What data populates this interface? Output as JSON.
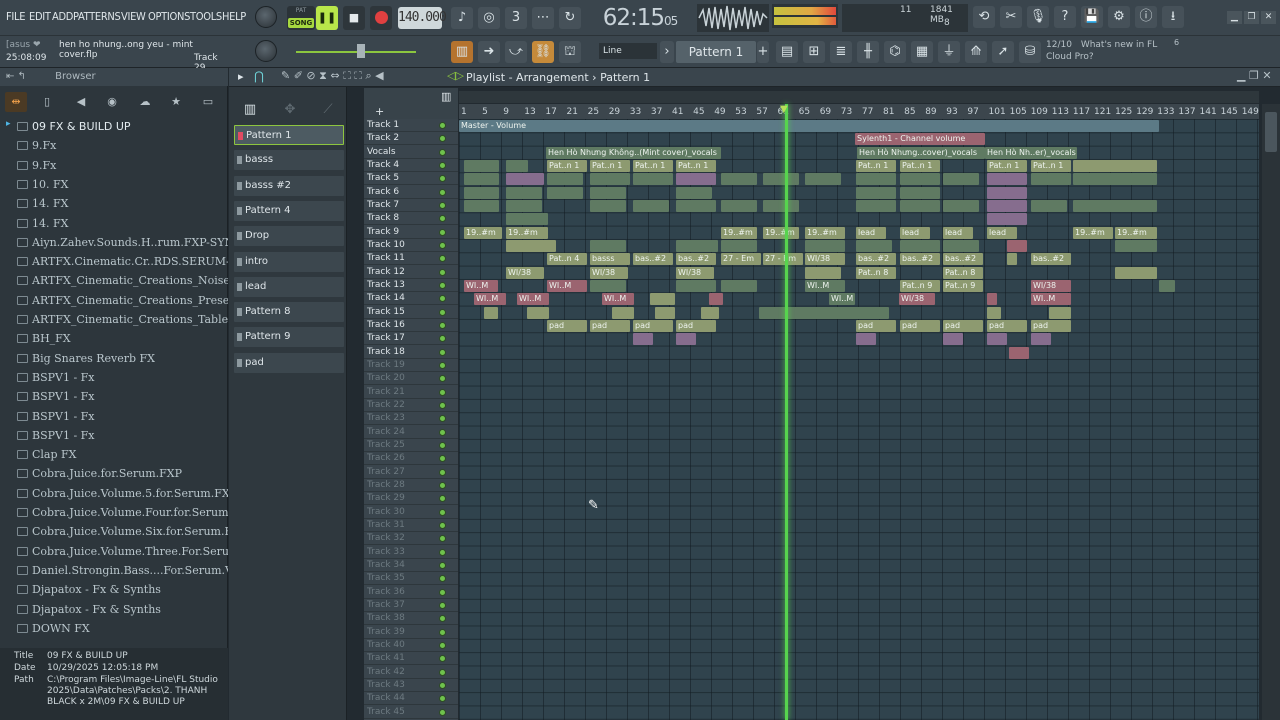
{
  "menu": [
    "FILE",
    "EDIT",
    "ADD",
    "PATTERNS",
    "VIEW",
    "OPTIONS",
    "TOOLS",
    "HELP"
  ],
  "transport": {
    "pat": "PAT",
    "song": "SONG",
    "tempo": "140.000",
    "time_main": "62:15",
    "time_sub": "05"
  },
  "cpu": {
    "poly": "11",
    "mem": "1841 MB",
    "voices": "8"
  },
  "hint": {
    "user": "[asus ❤",
    "song": "hen ho nhung..ong yeu - mint cover.flp",
    "time": "25:08:09",
    "track": "Track 29"
  },
  "snap": "Line",
  "pattern_selector": "Pattern 1",
  "news": {
    "count": "12/10",
    "text": "What's new in FL Cloud Pro?",
    "badge": "6"
  },
  "browser": {
    "title": "Browser",
    "items": [
      "09 FX & BUILD UP",
      "9.Fx",
      "9.Fx",
      "10. FX",
      "14. FX",
      "14. FX",
      "Aiyn.Zahev.Sounds.H..rum.FXP-SYNTHIC4TE",
      "ARTFX.Cinematic.Cr..RDS.SERUM-DISCOVER",
      "ARTFX_Cinematic_Creations_Noises",
      "ARTFX_Cinematic_Creations_Presets",
      "ARTFX_Cinematic_Creations_Tables",
      "BH_FX",
      "Big Snares Reverb FX",
      "BSPV1 - Fx",
      "BSPV1 - Fx",
      "BSPV1 - Fx",
      "BSPV1 - Fx",
      "Clap FX",
      "Cobra.Juice.for.Serum.FXP",
      "Cobra.Juice.Volume.5.for.Serum.FXP",
      "Cobra.Juice.Volume.Four.for.Serum.FXP",
      "Cobra.Juice.Volume.Six.for.Serum.FXP",
      "Cobra.Juice.Volume.Three.For.Serum.FXP",
      "Daniel.Strongin.Bass....For.Serum.Vol.1.FXP",
      "Djapatox - Fx & Synths",
      "Djapatox - Fx & Synths",
      "DOWN FX"
    ],
    "info": {
      "title_k": "Title",
      "title_v": "09 FX & BUILD UP",
      "date_k": "Date",
      "date_v": "10/29/2025 12:05:18 PM",
      "path_k": "Path",
      "path_v": "C:\\Program Files\\Image-Line\\FL Studio 2025\\Data\\Patches\\Packs\\2. THANH BLACK x 2M\\09 FX & BUILD UP"
    }
  },
  "patterns": [
    "Pattern 1",
    "basss",
    "basss #2",
    "Pattern 4",
    "Drop",
    "intro",
    "lead",
    "Pattern 8",
    "Pattern 9",
    "pad"
  ],
  "playlist": {
    "title": "Playlist - Arrangement",
    "pattern": "Pattern 1",
    "ruler": [
      "1",
      "5",
      "9",
      "13",
      "17",
      "21",
      "25",
      "29",
      "33",
      "37",
      "41",
      "45",
      "49",
      "53",
      "57",
      "61",
      "65",
      "69",
      "73",
      "77",
      "81",
      "85",
      "89",
      "93",
      "97",
      "101",
      "105",
      "109",
      "113",
      "117",
      "121",
      "125",
      "129",
      "133",
      "137",
      "141",
      "145",
      "149"
    ],
    "tracks": [
      "Track 1",
      "Track 2",
      "Vocals",
      "Track 4",
      "Track 5",
      "Track 6",
      "Track 7",
      "Track 8",
      "Track 9",
      "Track 10",
      "Track 11",
      "Track 12",
      "Track 13",
      "Track 14",
      "Track 15",
      "Track 16",
      "Track 17",
      "Track 18",
      "Track 19",
      "Track 20",
      "Track 21",
      "Track 22",
      "Track 23",
      "Track 24",
      "Track 25",
      "Track 26",
      "Track 27",
      "Track 28",
      "Track 29",
      "Track 30",
      "Track 31",
      "Track 32",
      "Track 33",
      "Track 34",
      "Track 35",
      "Track 36",
      "Track 37",
      "Track 38",
      "Track 39",
      "Track 40",
      "Track 41",
      "Track 42",
      "Track 43",
      "Track 44",
      "Track 45"
    ],
    "clips": {
      "master_volume": "Master - Volume",
      "synth_volume": "Sylenth1 - Channel volume",
      "vocal1": "Hen Hò Nhưng Không..(Mint cover)_vocals",
      "vocal2": "Hen Hò Nhưng..cover)_vocals",
      "vocal3": "Hen Hò Nh..er)_vocals",
      "pat_n1": "Pat..n 1",
      "pat_n4": "Pat..n 4",
      "pat_n8": "Pat..n 8",
      "pat_n9": "Pat..n 9",
      "basss": "basss",
      "bas2": "bas..#2",
      "lead": "lead",
      "pad": "pad",
      "wi38": "WI/38",
      "wim": "WI..M",
      "n19": "19..#m",
      "n27": "27 - Em"
    }
  }
}
